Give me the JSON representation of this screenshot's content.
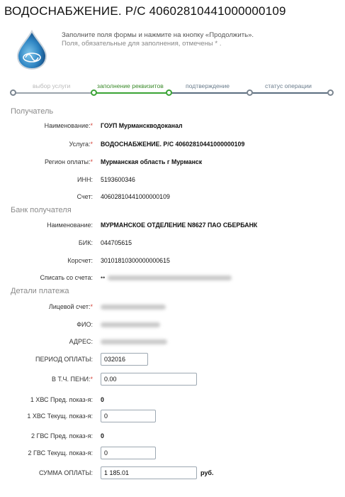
{
  "page": {
    "title": "ВОДОСНАБЖЕНИЕ. Р/С 40602810441000000109"
  },
  "intro": {
    "line1": "Заполните поля формы и нажмите на кнопку «Продолжить».",
    "line2": "Поля, обязательные для заполнения, отмечены * ."
  },
  "steps": [
    {
      "label": "выбор услуги",
      "state": "done"
    },
    {
      "label": "заполнение реквизитов",
      "state": "active"
    },
    {
      "label": "подтверждение",
      "state": "todo"
    },
    {
      "label": "статус операции",
      "state": "todo"
    }
  ],
  "recipient": {
    "title": "Получатель",
    "name_label": "Наименование:",
    "name_value": "ГОУП Мурманскводоканал",
    "service_label": "Услуга:",
    "service_value": "ВОДОСНАБЖЕНИЕ. Р/С 40602810441000000109",
    "region_label": "Регион оплаты:",
    "region_value": "Мурманская область г Мурманск",
    "inn_label": "ИНН:",
    "inn_value": "5193600346",
    "account_label": "Счет:",
    "account_value": "40602810441000000109"
  },
  "bank": {
    "title": "Банк получателя",
    "name_label": "Наименование:",
    "name_value": "МУРМАНСКОЕ ОТДЕЛЕНИЕ N8627 ПАО СБЕРБАНК",
    "bik_label": "БИК:",
    "bik_value": "044705615",
    "corr_label": "Корсчет:",
    "corr_value": "30101810300000000615",
    "debit_label": "Списать со счета:",
    "debit_value": "••"
  },
  "details": {
    "title": "Детали платежа",
    "personal_label": "Лицевой счет:",
    "fio_label": "ФИО:",
    "address_label": "АДРЕС:",
    "period_label": "ПЕРИОД ОПЛАТЫ:",
    "period_value": "032016",
    "fine_label": "В Т.Ч. ПЕНИ:",
    "fine_value": "0.00",
    "hvs_prev_label": "1 ХВС Пред. показ-я:",
    "hvs_prev_value": "0",
    "hvs_cur_label": "1 ХВС Текущ. показ-я:",
    "hvs_cur_value": "0",
    "gvs_prev_label": "2 ГВС Пред. показ-я:",
    "gvs_prev_value": "0",
    "gvs_cur_label": "2 ГВС Текущ. показ-я:",
    "gvs_cur_value": "0",
    "sum_label": "СУММА ОПЛАТЫ:",
    "sum_value": "1 185.01",
    "sum_suffix": "руб."
  },
  "required_mark": "*",
  "colors": {
    "active_step": "#3aa335",
    "done_step": "#7a8590",
    "required": "#d4433a"
  }
}
